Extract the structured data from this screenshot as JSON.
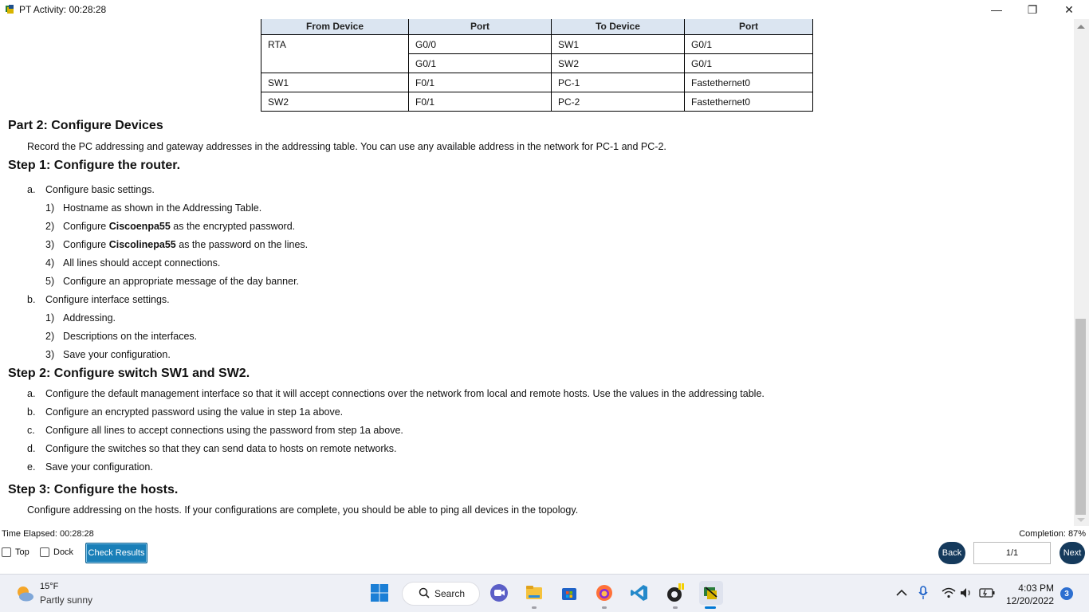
{
  "window": {
    "title": "PT Activity: 00:28:28",
    "minimize": "—",
    "maximize": "❐",
    "close": "✕"
  },
  "table": {
    "headers": [
      "From Device",
      "Port",
      "To Device",
      "Port"
    ],
    "rows": [
      [
        "RTA",
        "G0/0",
        "SW1",
        "G0/1"
      ],
      [
        "",
        "G0/1",
        "SW2",
        "G0/1"
      ],
      [
        "SW1",
        "F0/1",
        "PC-1",
        "Fastethernet0"
      ],
      [
        "SW2",
        "F0/1",
        "PC-2",
        "Fastethernet0"
      ]
    ]
  },
  "part2": {
    "heading": "Part 2: Configure Devices",
    "intro": "Record the PC addressing and gateway addresses in the addressing table. You can use any available address in the network for PC-1 and PC-2."
  },
  "step1": {
    "heading": "Step 1: Configure the router.",
    "a": {
      "marker": "a.",
      "text": "Configure basic settings."
    },
    "a_items": [
      {
        "n": "1)",
        "pre": "Hostname as shown in the Addressing Table.",
        "bold": "",
        "post": ""
      },
      {
        "n": "2)",
        "pre": "Configure ",
        "bold": "Ciscoenpa55",
        "post": " as the encrypted password."
      },
      {
        "n": "3)",
        "pre": "Configure ",
        "bold": "Ciscolinepa55",
        "post": " as the password on the lines."
      },
      {
        "n": "4)",
        "pre": "All lines should accept connections.",
        "bold": "",
        "post": ""
      },
      {
        "n": "5)",
        "pre": "Configure an appropriate message of the day banner.",
        "bold": "",
        "post": ""
      }
    ],
    "b": {
      "marker": "b.",
      "text": "Configure interface settings."
    },
    "b_items": [
      {
        "n": "1)",
        "text": "Addressing."
      },
      {
        "n": "2)",
        "text": "Descriptions on the interfaces."
      },
      {
        "n": "3)",
        "text": "Save your configuration."
      }
    ]
  },
  "step2": {
    "heading": "Step 2: Configure switch SW1 and SW2.",
    "items": [
      {
        "marker": "a.",
        "text": "Configure the default management interface so that it will accept connections over the network from local and remote hosts. Use the values in the addressing table."
      },
      {
        "marker": "b.",
        "text": "Configure an encrypted password using the value in step 1a above."
      },
      {
        "marker": "c.",
        "text": "Configure all lines to accept connections using the password from step 1a above."
      },
      {
        "marker": "d.",
        "text": "Configure the switches so that they can send data to hosts on remote networks."
      },
      {
        "marker": "e.",
        "text": "Save your configuration."
      }
    ]
  },
  "step3": {
    "heading": "Step 3: Configure the hosts.",
    "text": "Configure addressing on the hosts. If your configurations are complete, you should be able to ping all devices in the topology."
  },
  "status": {
    "time_elapsed": "Time Elapsed: 00:28:28",
    "completion": "Completion: 87%",
    "top_label": "Top",
    "dock_label": "Dock",
    "check_results": "Check Results",
    "back": "Back",
    "page": "1/1",
    "next": "Next"
  },
  "taskbar": {
    "temp": "15°F",
    "weather": "Partly sunny",
    "search": "Search",
    "time": "4:03 PM",
    "date": "12/20/2022",
    "notifications": "3"
  },
  "colors": {
    "header_fill": "#dbe5f1",
    "check_button": "#1a7fb8",
    "nav_button": "#153a5c",
    "win_blue": "#0078d4"
  }
}
